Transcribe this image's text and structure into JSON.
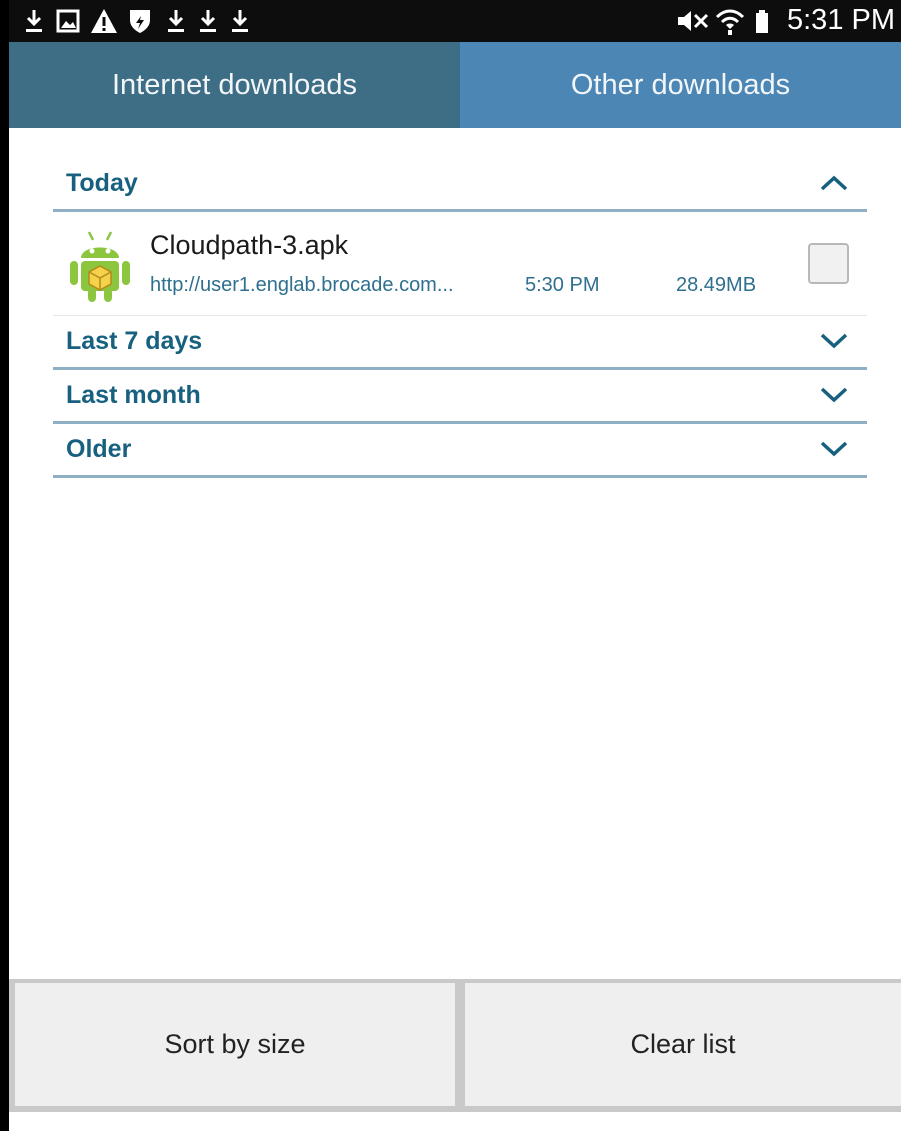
{
  "status_bar": {
    "time": "5:31 PM",
    "icons": [
      "download-icon",
      "gallery-icon",
      "warning-icon",
      "shield-icon",
      "download-icon",
      "download-icon",
      "download-icon",
      "mute-icon",
      "wifi-icon",
      "battery-icon"
    ]
  },
  "tabs": [
    {
      "label": "Internet downloads"
    },
    {
      "label": "Other downloads"
    }
  ],
  "sections": {
    "today": {
      "label": "Today",
      "expanded": true
    },
    "last7": {
      "label": "Last 7 days",
      "expanded": false
    },
    "lastmonth": {
      "label": "Last month",
      "expanded": false
    },
    "older": {
      "label": "Older",
      "expanded": false
    }
  },
  "download": {
    "name": "Cloudpath-3.apk",
    "url": "http://user1.englab.brocade.com...",
    "time": "5:30 PM",
    "size": "28.49MB",
    "icon": "android-icon"
  },
  "buttons": {
    "sort": "Sort by size",
    "clear": "Clear list"
  },
  "colors": {
    "tab_internet": "#3e6d86",
    "tab_other": "#4b86b5",
    "section_text": "#17607f",
    "divider": "#8fb0c4"
  }
}
